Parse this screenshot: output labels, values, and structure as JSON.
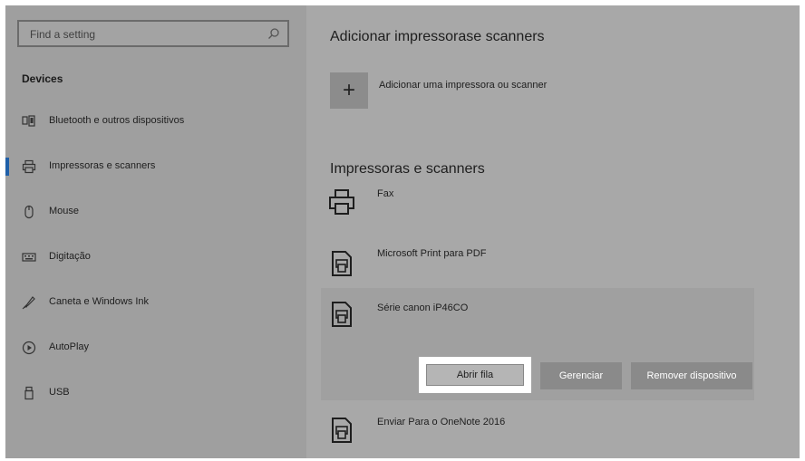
{
  "search": {
    "placeholder": "Find a setting",
    "icon": "search-icon"
  },
  "sidebar": {
    "title": "Devices",
    "items": [
      {
        "label": "Bluetooth e outros dispositivos",
        "icon": "bluetooth-devices-icon",
        "selected": false
      },
      {
        "label": "Impressoras e scanners",
        "icon": "printer-icon",
        "selected": true
      },
      {
        "label": "Mouse",
        "icon": "mouse-icon",
        "selected": false
      },
      {
        "label": "Digitação",
        "icon": "keyboard-icon",
        "selected": false
      },
      {
        "label": "Caneta e Windows Ink",
        "icon": "pen-icon",
        "selected": false
      },
      {
        "label": "AutoPlay",
        "icon": "autoplay-icon",
        "selected": false
      },
      {
        "label": "USB",
        "icon": "usb-icon",
        "selected": false
      }
    ]
  },
  "main": {
    "add_section_title": "Adicionar impressorase scanners",
    "add_button_symbol": "+",
    "add_button_label": "Adicionar uma impressora ou scanner",
    "printers_section_title": "Impressoras e scanners",
    "printers": [
      {
        "name": "Fax",
        "icon": "printer-icon"
      },
      {
        "name": "Microsoft Print para PDF",
        "icon": "printer-document-icon"
      },
      {
        "name": "Série canon iP46CO",
        "icon": "printer-document-icon",
        "expanded": true
      },
      {
        "name": "Enviar Para o OneNote 2016",
        "icon": "printer-document-icon"
      }
    ],
    "actions": {
      "open_queue": "Abrir fila",
      "manage": "Gerenciar",
      "remove": "Remover dispositivo"
    }
  }
}
